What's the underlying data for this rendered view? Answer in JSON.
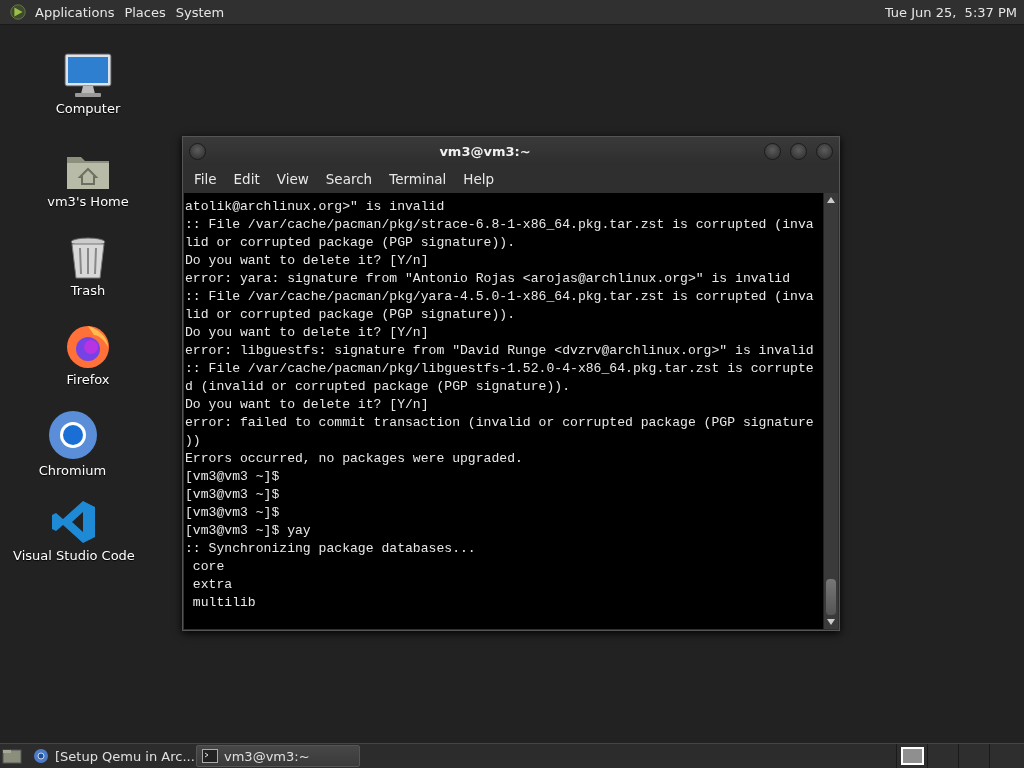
{
  "top_panel": {
    "menus": [
      "Applications",
      "Places",
      "System"
    ],
    "clock": "Tue Jun 25,  5:37 PM"
  },
  "desktop_icons": [
    {
      "kind": "computer",
      "label": "Computer"
    },
    {
      "kind": "home",
      "label": "vm3's Home"
    },
    {
      "kind": "trash",
      "label": "Trash"
    },
    {
      "kind": "firefox",
      "label": "Firefox"
    },
    {
      "kind": "chromium",
      "label": "Chromium"
    },
    {
      "kind": "vscode",
      "label": "Visual Studio Code"
    }
  ],
  "terminal": {
    "title": "vm3@vm3:~",
    "menus": [
      "File",
      "Edit",
      "View",
      "Search",
      "Terminal",
      "Help"
    ],
    "lines": [
      "atolik@archlinux.org>\" is invalid",
      ":: File /var/cache/pacman/pkg/strace-6.8-1-x86_64.pkg.tar.zst is corrupted (inva",
      "lid or corrupted package (PGP signature)).",
      "Do you want to delete it? [Y/n]",
      "error: yara: signature from \"Antonio Rojas <arojas@archlinux.org>\" is invalid",
      ":: File /var/cache/pacman/pkg/yara-4.5.0-1-x86_64.pkg.tar.zst is corrupted (inva",
      "lid or corrupted package (PGP signature)).",
      "Do you want to delete it? [Y/n]",
      "error: libguestfs: signature from \"David Runge <dvzrv@archlinux.org>\" is invalid",
      ":: File /var/cache/pacman/pkg/libguestfs-1.52.0-4-x86_64.pkg.tar.zst is corrupte",
      "d (invalid or corrupted package (PGP signature)).",
      "Do you want to delete it? [Y/n]",
      "error: failed to commit transaction (invalid or corrupted package (PGP signature",
      "))",
      "Errors occurred, no packages were upgraded.",
      "[vm3@vm3 ~]$",
      "[vm3@vm3 ~]$",
      "[vm3@vm3 ~]$",
      "[vm3@vm3 ~]$ yay",
      ":: Synchronizing package databases...",
      " core",
      " extra",
      " multilib"
    ]
  },
  "taskbar": {
    "tasks": [
      {
        "kind": "browser",
        "label": "[Setup Qemu in Arc...",
        "selected": false
      },
      {
        "kind": "terminal",
        "label": "vm3@vm3:~",
        "selected": true
      }
    ],
    "workspaces": [
      {
        "selected": true
      },
      {
        "selected": false
      },
      {
        "selected": false
      },
      {
        "selected": false
      }
    ]
  }
}
